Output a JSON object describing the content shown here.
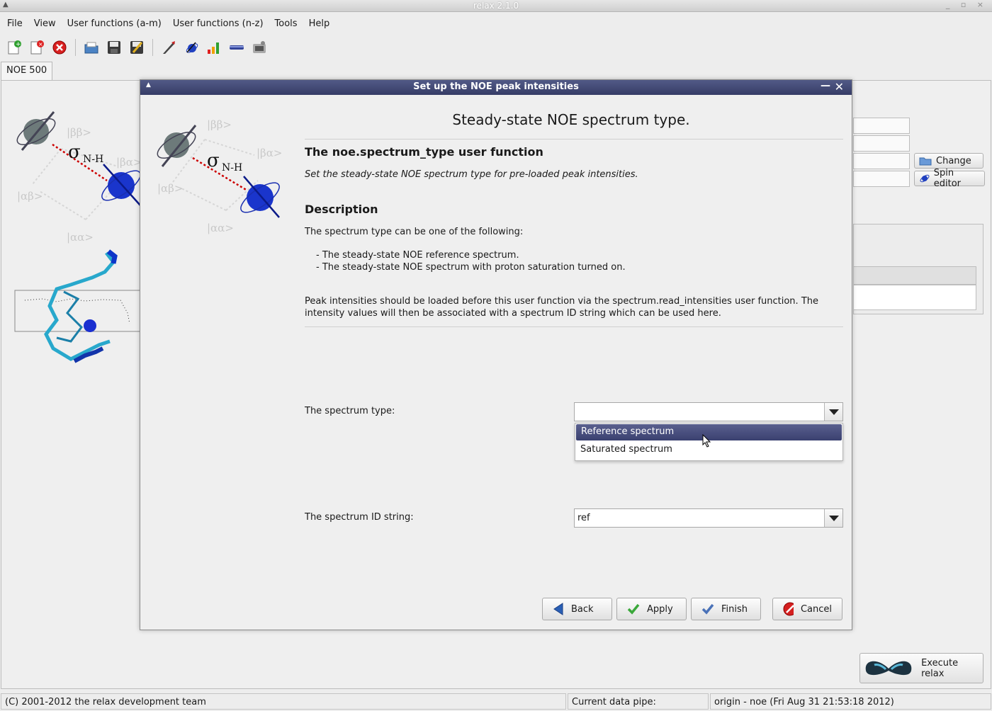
{
  "window": {
    "title": "relax 2.1.0"
  },
  "menubar": [
    "File",
    "View",
    "User functions (a-m)",
    "User functions (n-z)",
    "Tools",
    "Help"
  ],
  "toolbar": {
    "icons": [
      "new-analysis-icon",
      "close-analysis-icon",
      "close-all-icon",
      "open-icon",
      "save-icon",
      "save-as-icon",
      "run-icon",
      "spin-viewer-icon",
      "results-icon",
      "pipe-editor-icon",
      "prompt-icon"
    ]
  },
  "tabs": [
    "NOE 500"
  ],
  "background": {
    "change_label": "Change",
    "spin_editor_label": "Spin editor",
    "execute_label": "Execute relax"
  },
  "statusbar": {
    "copyright": "(C) 2001-2012 the relax development team",
    "pipe_label": "Current data pipe:",
    "pipe_value": "origin - noe (Fri Aug 31 21:53:18 2012)"
  },
  "dialog": {
    "title": "Set up the NOE peak intensities",
    "heading": "Steady-state NOE spectrum type.",
    "uf_title": "The noe.spectrum_type user function",
    "uf_synopsis": "Set the steady-state NOE spectrum type for pre-loaded peak intensities.",
    "desc_heading": "Description",
    "desc_p1": "The spectrum type can be one of the following:",
    "desc_list": [
      "- The steady-state NOE reference spectrum.",
      "- The steady-state NOE spectrum with proton saturation turned on."
    ],
    "desc_p2": "Peak intensities should be loaded before this user function via the spectrum.read_intensities user function.  The intensity values will then be associated with a spectrum ID string which can be used here.",
    "spectrum_type_label": "The spectrum type:",
    "spectrum_type_value": "",
    "spectrum_type_options": [
      "Reference spectrum",
      "Saturated spectrum"
    ],
    "spectrum_type_highlighted": "Reference spectrum",
    "spectrum_id_label": "The spectrum ID string:",
    "spectrum_id_value": "ref",
    "buttons": {
      "back": "Back",
      "apply": "Apply",
      "finish": "Finish",
      "cancel": "Cancel"
    }
  },
  "graphic_text": {
    "sigma": "σ",
    "subscript": "N-H",
    "states": [
      "|ββ>",
      "|βα>",
      "|αβ>",
      "|αα>"
    ]
  },
  "colors": {
    "dialog_title": "#3d4370",
    "highlight": "#4a507e"
  }
}
